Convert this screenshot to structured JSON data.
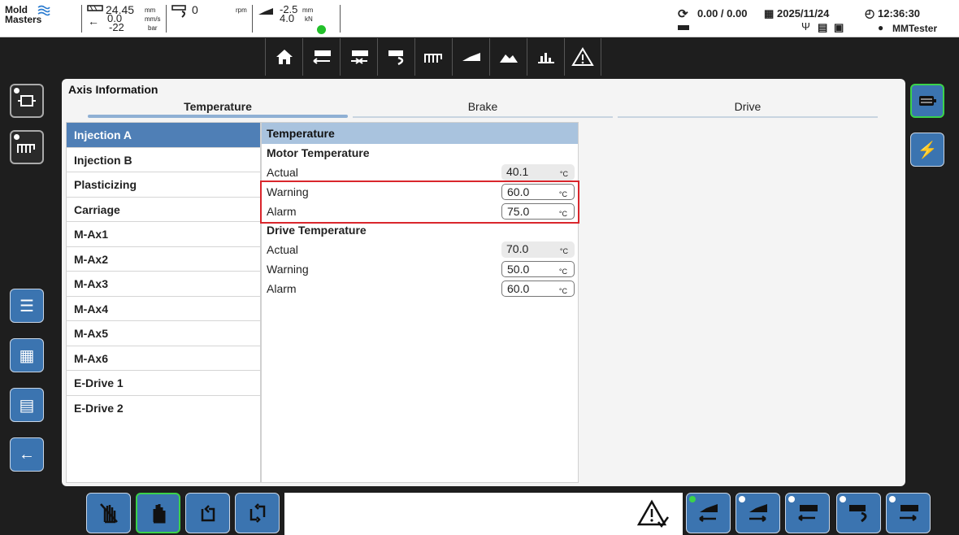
{
  "header": {
    "logo_line1": "Mold",
    "logo_line2": "Masters",
    "injection_value": "24.45",
    "injection_unit": "mm",
    "speed_value": "0.0",
    "speed_unit": "mm/s",
    "pressure_value": "-22",
    "pressure_unit": "bar",
    "screw_value": "0",
    "screw_unit": "rpm",
    "carriage_value1": "-2.5",
    "carriage_unit1": "mm",
    "carriage_value2": "4.0",
    "carriage_unit2": "kN",
    "cycle": "0.00 / 0.00",
    "date": "2025/11/24",
    "time": "12:36:30",
    "user": "MMTester"
  },
  "toolbar": {
    "icons": [
      "home-icon",
      "injection-icon",
      "hold-icon",
      "screw-icon",
      "heater-icon",
      "carriage-icon",
      "mold-icon",
      "chart-icon",
      "alarm-icon"
    ]
  },
  "panel": {
    "title": "Axis Information",
    "tabs": [
      "Temperature",
      "Brake",
      "Drive"
    ],
    "active_tab": "Temperature"
  },
  "axes": [
    "Injection A",
    "Injection B",
    "Plasticizing",
    "Carriage",
    "M-Ax1",
    "M-Ax2",
    "M-Ax3",
    "M-Ax4",
    "M-Ax5",
    "M-Ax6",
    "E-Drive 1",
    "E-Drive 2"
  ],
  "detail": {
    "header": "Temperature",
    "motor": {
      "title": "Motor Temperature",
      "actual_label": "Actual",
      "actual_value": "40.1",
      "warning_label": "Warning",
      "warning_value": "60.0",
      "alarm_label": "Alarm",
      "alarm_value": "75.0"
    },
    "drive": {
      "title": "Drive Temperature",
      "actual_label": "Actual",
      "actual_value": "70.0",
      "warning_label": "Warning",
      "warning_value": "50.0",
      "alarm_label": "Alarm",
      "alarm_value": "60.0"
    },
    "unit": "°C"
  },
  "colors": {
    "accent": "#3b74b0",
    "selected_row": "#4f7fb6",
    "highlight": "#d9262c",
    "active_border": "#3bd24a"
  }
}
